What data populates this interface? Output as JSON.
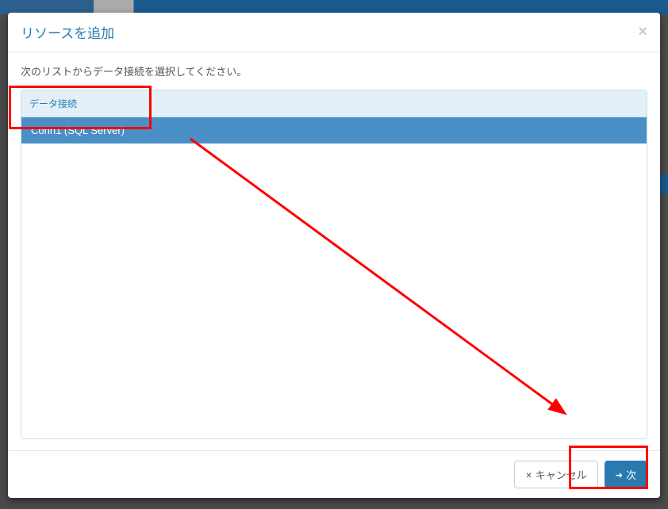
{
  "modal": {
    "title": "リソースを追加",
    "close": "×",
    "instruction": "次のリストからデータ接続を選択してください。",
    "list_header": "データ接続",
    "items": [
      {
        "label": "Conn1 (SQL Server)",
        "selected": true
      }
    ],
    "cancel_label": "キャンセル",
    "next_label": "次"
  }
}
